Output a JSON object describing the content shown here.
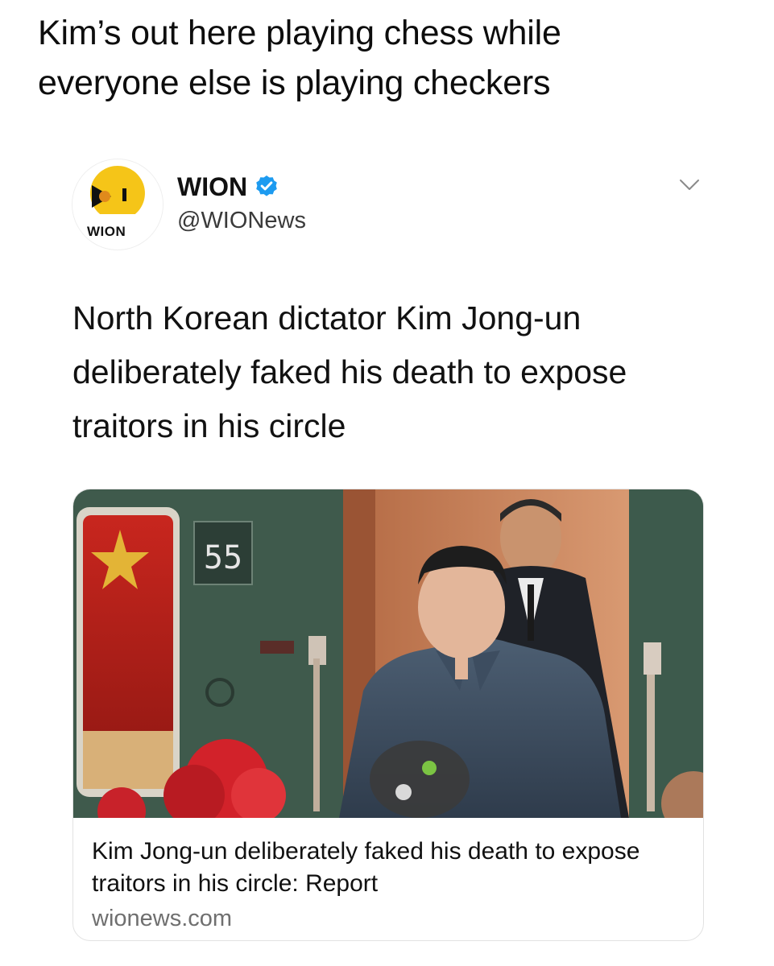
{
  "caption": {
    "line1": "Kim’s out here playing chess while",
    "line2": "everyone else is playing checkers"
  },
  "tweet": {
    "avatar_logo_text": "WION",
    "display_name": "WION",
    "verified_icon": "verified-badge-icon",
    "handle": "@WIONews",
    "menu_icon": "chevron-down-icon",
    "text": "North Korean dictator Kim Jong-un deliberately faked his death to expose traitors in his circle"
  },
  "card": {
    "image_label": "55",
    "title": "Kim Jong-un deliberately faked his death to expose traitors in his circle: Report",
    "domain": "wionews.com"
  },
  "colors": {
    "verified_blue": "#1d9bf0",
    "logo_yellow": "#f5c518",
    "train_green": "#3f5a4c",
    "handle_gray": "#3a3a3a",
    "domain_gray": "#6f6f6f"
  }
}
